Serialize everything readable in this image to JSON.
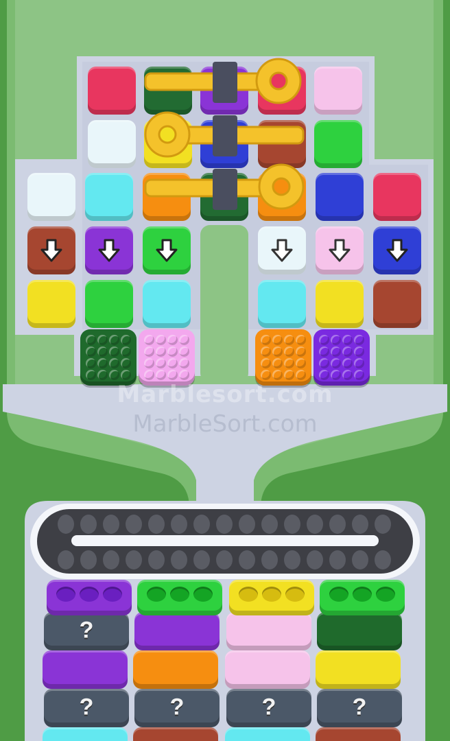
{
  "game": "Marble Sort",
  "colors": {
    "background": "#4f9c45",
    "frame": "#7bbb71",
    "panel": "#8dc485",
    "board_bg": "#cdd3e3",
    "belt": "#3e3f45",
    "pin_gold": "#f4c22b",
    "pin_post": "#4a4e5f"
  },
  "top_tiles": [
    {
      "name": "tile-pink-red",
      "color": "#e8365f"
    },
    {
      "name": "tile-dark-green",
      "color": "#226b32"
    },
    {
      "name": "tile-purple",
      "color": "#8a34d6"
    },
    {
      "name": "tile-pink-red-2",
      "color": "#e8365f"
    },
    {
      "name": "tile-light-pink",
      "color": "#f6c3ea"
    },
    {
      "name": "tile-white",
      "color": "#e9f6fa"
    },
    {
      "name": "tile-yellow",
      "color": "#f2e022"
    },
    {
      "name": "tile-blue",
      "color": "#2f3fd6"
    },
    {
      "name": "tile-brown",
      "color": "#a64630"
    },
    {
      "name": "tile-green",
      "color": "#2ed13f"
    },
    {
      "name": "tile-white-2",
      "color": "#e9f6fa"
    },
    {
      "name": "tile-cyan",
      "color": "#63e8f0"
    },
    {
      "name": "tile-orange",
      "color": "#f68e10"
    },
    {
      "name": "tile-dark-green-2",
      "color": "#226b32"
    },
    {
      "name": "tile-orange-2",
      "color": "#f68e10"
    },
    {
      "name": "tile-blue-2",
      "color": "#2f3fd6"
    },
    {
      "name": "tile-pink-red-3",
      "color": "#e8365f"
    }
  ],
  "arrow_tiles": [
    {
      "color": "#a64630",
      "arrow": "down-arrow-icon"
    },
    {
      "color": "#8a34d6",
      "arrow": "down-arrow-icon"
    },
    {
      "color": "#2ed13f",
      "arrow": "down-arrow-icon"
    },
    {
      "color": "#e9f6fa",
      "arrow": "down-arrow-icon"
    },
    {
      "color": "#f6c3ea",
      "arrow": "down-arrow-icon"
    },
    {
      "color": "#2f3fd6",
      "arrow": "down-arrow-icon"
    }
  ],
  "bottom_tiles": [
    {
      "color": "#f2e022"
    },
    {
      "color": "#2ed13f"
    },
    {
      "color": "#63e8f0"
    },
    {
      "color": "#63e8f0"
    },
    {
      "color": "#f2e022"
    },
    {
      "color": "#a64630"
    }
  ],
  "pop_boxes": [
    {
      "name": "pop-box-dark-green",
      "color": "#1f6a2c"
    },
    {
      "name": "pop-box-pink",
      "color": "#f3a8ee"
    },
    {
      "name": "pop-box-orange",
      "color": "#f68e10"
    },
    {
      "name": "pop-box-purple",
      "color": "#7a2ae0"
    }
  ],
  "watermarks": {
    "line1": "Marblesort.com",
    "line2": "MarbleSort.com"
  },
  "tray_columns": [
    {
      "top": "#8a34d6",
      "slots": "#6a1fc0",
      "stack": [
        {
          "color": "#4b5868",
          "mystery": true
        },
        {
          "color": "#8a34d6"
        },
        {
          "color": "#4b5868",
          "mystery": true
        },
        {
          "color": "#63e8f0"
        }
      ]
    },
    {
      "top": "#2ed13f",
      "slots": "#14a424",
      "stack": [
        {
          "color": "#8a34d6"
        },
        {
          "color": "#f68e10"
        },
        {
          "color": "#4b5868",
          "mystery": true
        },
        {
          "color": "#a64630"
        }
      ]
    },
    {
      "top": "#f2e022",
      "slots": "#d6bc10",
      "stack": [
        {
          "color": "#f6c3ea"
        },
        {
          "color": "#f6c3ea"
        },
        {
          "color": "#4b5868",
          "mystery": true
        },
        {
          "color": "#63e8f0"
        }
      ]
    },
    {
      "top": "#2ed13f",
      "slots": "#14a424",
      "stack": [
        {
          "color": "#1f6a2c"
        },
        {
          "color": "#f2e022"
        },
        {
          "color": "#4b5868",
          "mystery": true
        },
        {
          "color": "#a64630"
        }
      ]
    }
  ],
  "mystery_symbol": "?"
}
